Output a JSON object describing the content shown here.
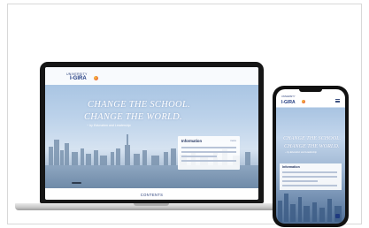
{
  "site": {
    "logo_sub": "UNIVERSITY",
    "logo_main": "I-GIRA",
    "nav_items": [
      "",
      "",
      "",
      "",
      "",
      ""
    ],
    "hero_line1": "CHANGE THE SCHOOL.",
    "hero_line2": "CHANGE THE WORLD.",
    "hero_sub": "~ by Education and Leadership",
    "info_title": "Information",
    "info_more": "more",
    "contents_label": "CONTENTS"
  },
  "phone": {
    "logo_sub": "UNIVERSITY",
    "logo_main": "I-GIRA",
    "hero_line1": "CHANGE THE SCHOOL.",
    "hero_line2": "CHANGE THE WORLD.",
    "hero_sub": "~ by Education and Leadership",
    "info_title": "Information"
  },
  "colors": {
    "brand": "#1f3a80",
    "sky": "#a9c4e2",
    "device": "#161616"
  }
}
